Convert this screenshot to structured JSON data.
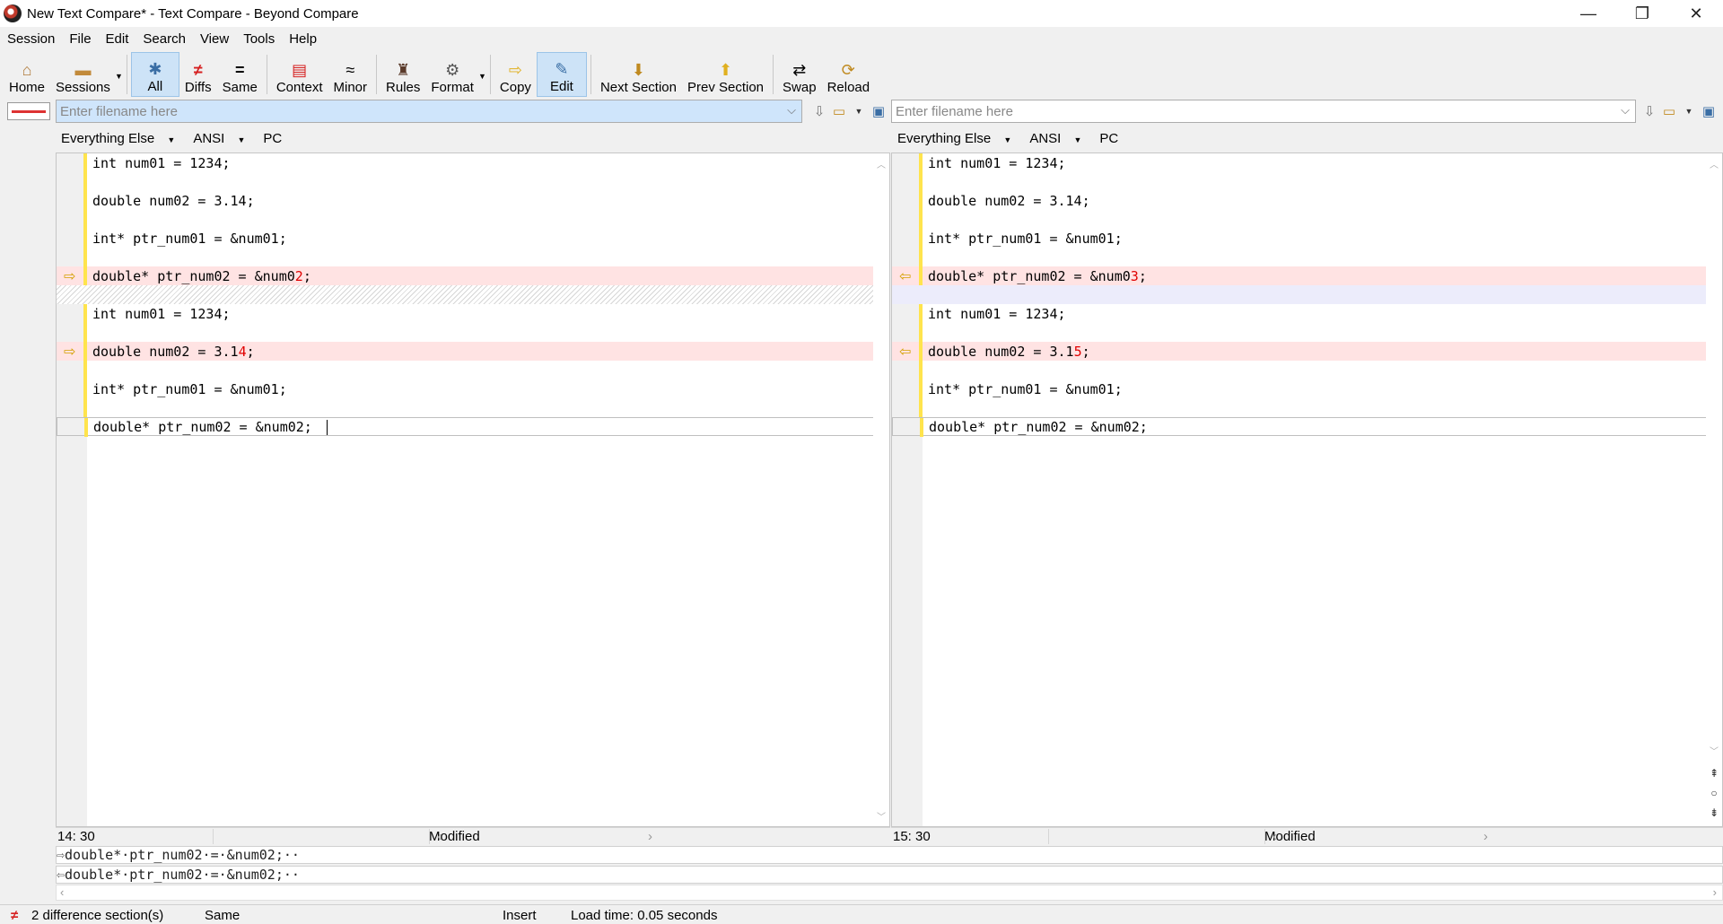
{
  "window": {
    "title": "New Text Compare* - Text Compare - Beyond Compare",
    "minimize": "—",
    "restore": "❐",
    "close": "✕"
  },
  "menu": [
    "Session",
    "File",
    "Edit",
    "Search",
    "View",
    "Tools",
    "Help"
  ],
  "toolbar": {
    "home": "Home",
    "sessions": "Sessions",
    "all": "All",
    "diffs": "Diffs",
    "same": "Same",
    "context": "Context",
    "minor": "Minor",
    "rules": "Rules",
    "format": "Format",
    "copy": "Copy",
    "edit": "Edit",
    "next_section": "Next Section",
    "prev_section": "Prev Section",
    "swap": "Swap",
    "reload": "Reload"
  },
  "left": {
    "path_placeholder": "Enter filename here",
    "format": "Everything Else",
    "encoding": "ANSI",
    "line_ending": "PC",
    "position": "14: 30",
    "status": "Modified",
    "lines": [
      {
        "type": "same",
        "text": "int num01 = 1234;"
      },
      {
        "type": "empty",
        "text": ""
      },
      {
        "type": "same",
        "text": "double num02 = 3.14;"
      },
      {
        "type": "empty",
        "text": ""
      },
      {
        "type": "same",
        "text": "int* ptr_num01 = &num01;"
      },
      {
        "type": "empty",
        "text": ""
      },
      {
        "type": "diff",
        "pre": "double* ptr_num02 = &num0",
        "hl": "2",
        "post": ";"
      },
      {
        "type": "hatch",
        "text": ""
      },
      {
        "type": "same",
        "text": "int num01 = 1234;"
      },
      {
        "type": "empty",
        "text": ""
      },
      {
        "type": "diff",
        "pre": "double num02 = 3.1",
        "hl": "4",
        "post": ";"
      },
      {
        "type": "empty",
        "text": ""
      },
      {
        "type": "same",
        "text": "int* ptr_num01 = &num01;"
      },
      {
        "type": "empty",
        "text": ""
      },
      {
        "type": "cursor",
        "text": "double* ptr_num02 = &num02;"
      }
    ]
  },
  "right": {
    "path_placeholder": "Enter filename here",
    "format": "Everything Else",
    "encoding": "ANSI",
    "line_ending": "PC",
    "position": "15: 30",
    "status": "Modified",
    "lines": [
      {
        "type": "same",
        "text": "int num01 = 1234;"
      },
      {
        "type": "empty",
        "text": ""
      },
      {
        "type": "same",
        "text": "double num02 = 3.14;"
      },
      {
        "type": "empty",
        "text": ""
      },
      {
        "type": "same",
        "text": "int* ptr_num01 = &num01;"
      },
      {
        "type": "empty",
        "text": ""
      },
      {
        "type": "diff",
        "pre": "double* ptr_num02 = &num0",
        "hl": "3",
        "post": ";"
      },
      {
        "type": "blank",
        "text": ""
      },
      {
        "type": "same",
        "text": "int num01 = 1234;"
      },
      {
        "type": "empty",
        "text": ""
      },
      {
        "type": "diff",
        "pre": "double num02 = 3.1",
        "hl": "5",
        "post": ";"
      },
      {
        "type": "empty",
        "text": ""
      },
      {
        "type": "same",
        "text": "int* ptr_num01 = &num01;"
      },
      {
        "type": "empty",
        "text": ""
      },
      {
        "type": "cursor",
        "text": "double* ptr_num02 = &num02;"
      }
    ]
  },
  "detail": {
    "left_line": "double*·ptr_num02·=·&num02;··",
    "right_line": "double*·ptr_num02·=·&num02;··"
  },
  "status": {
    "diff_count": "2 difference section(s)",
    "same": "Same",
    "mode": "Insert",
    "load_time": "Load time: 0.05 seconds"
  },
  "colors": {
    "diff_bg": "#ffe3e3",
    "diff_text": "#e00000",
    "change_bar": "#ffe44d",
    "active_button": "#cde3f7"
  }
}
